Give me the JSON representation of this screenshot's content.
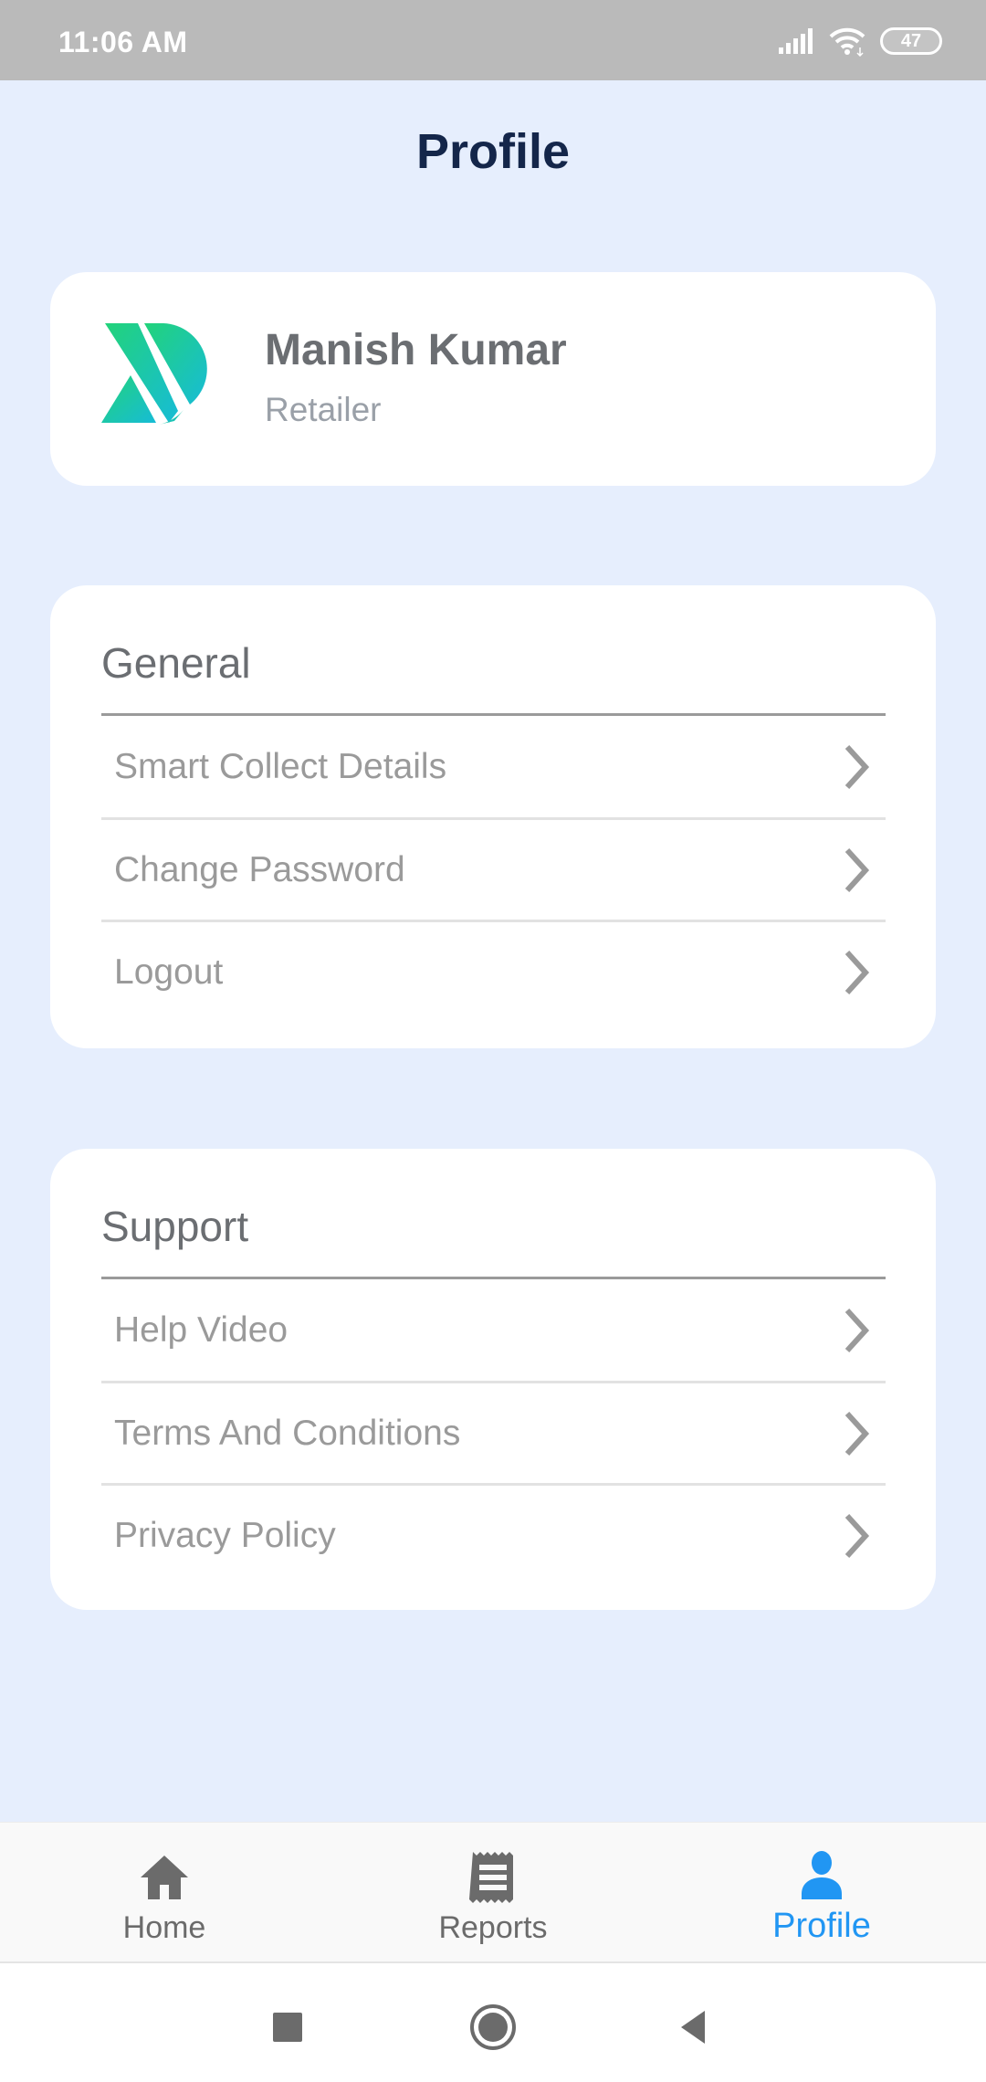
{
  "status_bar": {
    "time": "11:06 AM",
    "battery_level": "47",
    "icons": [
      "signal-icon",
      "wifi-icon",
      "battery-icon"
    ]
  },
  "header": {
    "title": "Profile"
  },
  "profile": {
    "name": "Manish Kumar",
    "role": "Retailer",
    "logo_colors": {
      "start": "#22d37a",
      "end": "#17bcd6"
    }
  },
  "sections": [
    {
      "title": "General",
      "items": [
        {
          "label": "Smart Collect Details",
          "icon": "chevron-right-icon"
        },
        {
          "label": "Change Password",
          "icon": "chevron-right-icon"
        },
        {
          "label": "Logout",
          "icon": "chevron-right-icon"
        }
      ]
    },
    {
      "title": "Support",
      "items": [
        {
          "label": "Help Video",
          "icon": "chevron-right-icon"
        },
        {
          "label": "Terms And Conditions",
          "icon": "chevron-right-icon"
        },
        {
          "label": "Privacy Policy",
          "icon": "chevron-right-icon"
        }
      ]
    }
  ],
  "bottom_nav": {
    "items": [
      {
        "label": "Home",
        "icon": "home-icon",
        "active": false
      },
      {
        "label": "Reports",
        "icon": "receipt-icon",
        "active": false
      },
      {
        "label": "Profile",
        "icon": "person-icon",
        "active": true
      }
    ],
    "active_color": "#2196f3",
    "inactive_color": "#6b6b6b"
  },
  "system_nav": {
    "buttons": [
      "recents-icon",
      "home-circle-icon",
      "back-icon"
    ]
  },
  "colors": {
    "background": "#e6eefd",
    "title": "#14264a",
    "status_bar": "#bababa"
  }
}
